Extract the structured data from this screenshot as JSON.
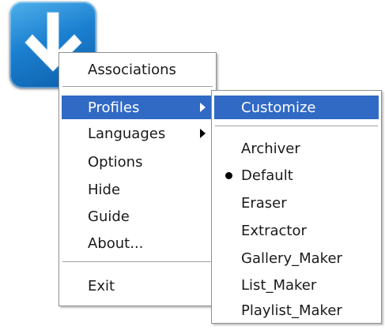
{
  "app_icon": {
    "name": "download-arrow-app-icon",
    "accent": "#1b7fd0"
  },
  "main_menu": {
    "items": [
      {
        "label": "Associations"
      },
      {
        "label": "Profiles",
        "has_submenu": true,
        "selected": true
      },
      {
        "label": "Languages",
        "has_submenu": true
      },
      {
        "label": "Options"
      },
      {
        "label": "Hide"
      },
      {
        "label": "Guide"
      },
      {
        "label": "About..."
      },
      {
        "label": "Exit"
      }
    ]
  },
  "profiles_submenu": {
    "items": [
      {
        "label": "Customize",
        "selected": true
      },
      {
        "label": "Archiver"
      },
      {
        "label": "Default",
        "checked": true
      },
      {
        "label": "Eraser"
      },
      {
        "label": "Extractor"
      },
      {
        "label": "Gallery_Maker"
      },
      {
        "label": "List_Maker"
      },
      {
        "label": "Playlist_Maker"
      }
    ]
  },
  "colors": {
    "selection": "#316ac5",
    "menu_border": "#8f8f8f"
  }
}
